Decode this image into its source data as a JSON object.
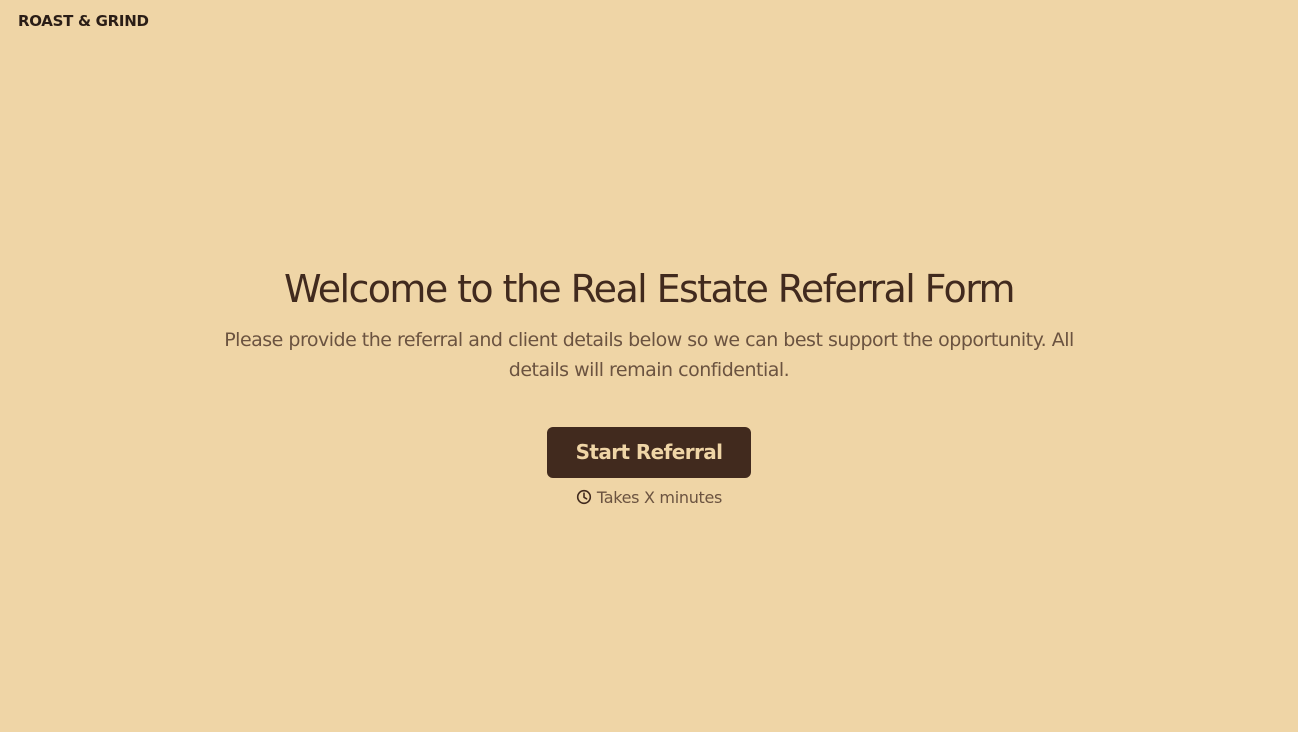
{
  "brand": {
    "logo_text": "ROAST & GRIND"
  },
  "welcome": {
    "title": "Welcome to the Real Estate Referral Form",
    "subtitle": "Please provide the referral and client details below so we can best support the opportunity. All details will remain confidential.",
    "start_button_label": "Start Referral",
    "duration_icon": "clock-icon",
    "duration_text": "Takes X minutes"
  },
  "colors": {
    "background": "#EFD5A6",
    "primary": "#412A1E",
    "muted_text": "#6B5340",
    "button_text": "#EFD5A6"
  }
}
